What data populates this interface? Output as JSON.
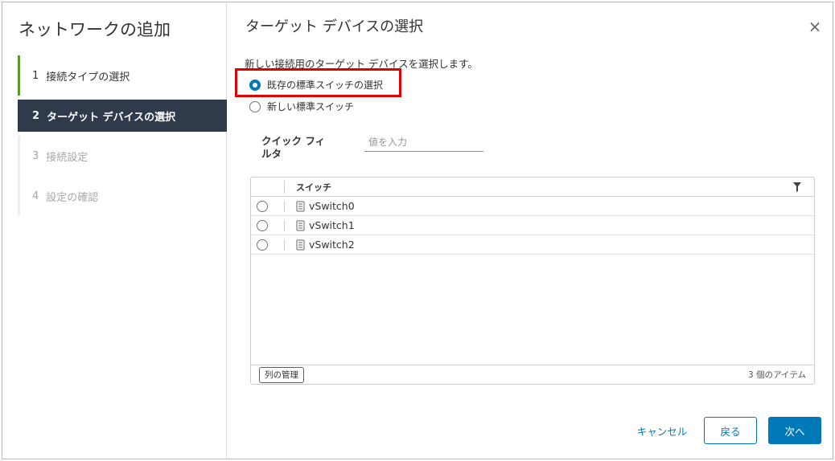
{
  "wizard": {
    "title": "ネットワークの追加",
    "steps": [
      {
        "num": "1",
        "label": "接続タイプの選択",
        "state": "done"
      },
      {
        "num": "2",
        "label": "ターゲット デバイスの選択",
        "state": "active"
      },
      {
        "num": "3",
        "label": "接続設定",
        "state": "pending"
      },
      {
        "num": "4",
        "label": "設定の確認",
        "state": "pending"
      }
    ]
  },
  "page": {
    "title": "ターゲット デバイスの選択",
    "instruction": "新しい接続用のターゲット デバイスを選択します。",
    "options": [
      {
        "label": "既存の標準スイッチの選択",
        "checked": true
      },
      {
        "label": "新しい標準スイッチ",
        "checked": false
      }
    ]
  },
  "filter": {
    "label": "クイック フィルタ",
    "placeholder": "値を入力"
  },
  "grid": {
    "column_header": "スイッチ",
    "rows": [
      {
        "name": "vSwitch0"
      },
      {
        "name": "vSwitch1"
      },
      {
        "name": "vSwitch2"
      }
    ],
    "manage_columns_label": "列の管理",
    "item_count": "3 個のアイテム"
  },
  "footer": {
    "cancel_label": "キャンセル",
    "back_label": "戻る",
    "next_label": "次へ"
  },
  "colors": {
    "accent": "#0079b8",
    "nav_active_bg": "#2f3b4a",
    "step_done_bar": "#5a9a2b",
    "highlight": "#e00000"
  },
  "icons": {
    "close": "close-icon",
    "filter": "filter-icon",
    "switch": "switch-icon"
  }
}
